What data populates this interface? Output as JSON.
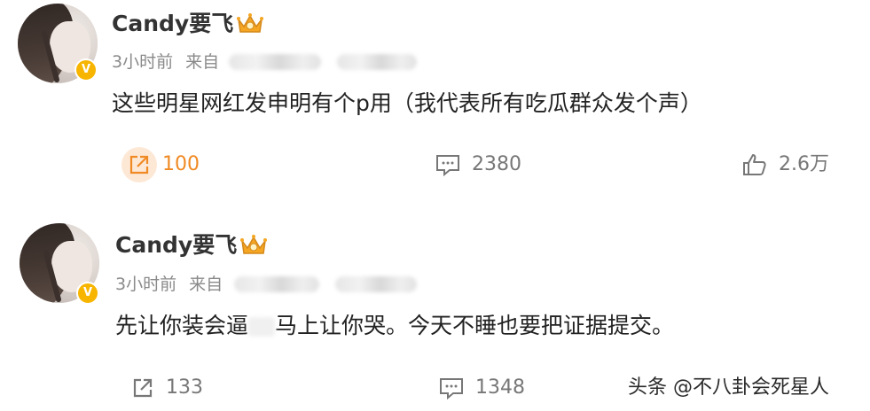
{
  "posts": [
    {
      "username": "Candy要飞",
      "time": "3小时前",
      "source_prefix": "来自",
      "content_before": "这些明星网红发申明有个p用（我代表所有吃瓜群众发个声）",
      "content_after": "",
      "repost_count": "100",
      "comment_count": "2380",
      "like_count": "2.6万",
      "repost_active": true
    },
    {
      "username": "Candy要飞",
      "time": "3小时前",
      "source_prefix": "来自",
      "content_before": "先让你装会逼",
      "content_after": "马上让你哭。今天不睡也要把证据提交。",
      "repost_count": "133",
      "comment_count": "1348",
      "like_count": "",
      "repost_active": false
    }
  ],
  "badge": {
    "verified_symbol": "V",
    "color": "#f7b500"
  },
  "icons": {
    "repost": "repost-icon",
    "comment": "comment-icon",
    "like": "like-icon",
    "crown": "crown-icon"
  },
  "accent_color": "#f08a24",
  "watermark": "头条 @不八卦会死星人"
}
